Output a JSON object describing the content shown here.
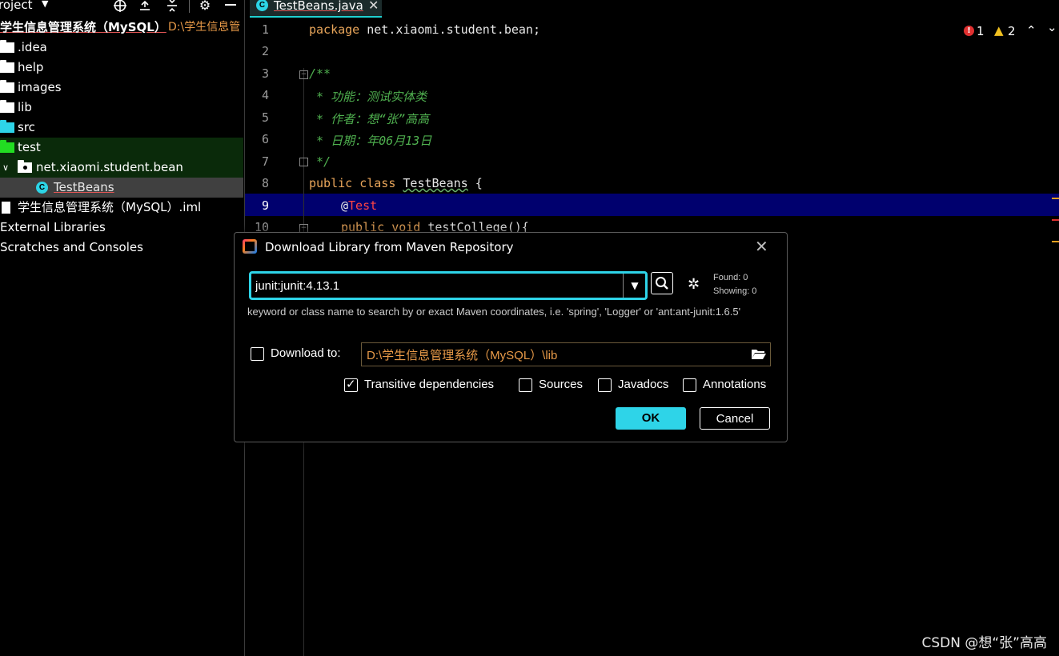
{
  "project_panel": {
    "title": "roject",
    "header_icons": [
      "crosshair-icon",
      "expand-all-icon",
      "collapse-all-icon",
      "gear-icon",
      "minimize-icon"
    ],
    "root": {
      "name": "学生信息管理系统（MySQL）",
      "path": "D:\\学生信息管"
    },
    "items": [
      {
        "label": ".idea",
        "type": "folder",
        "color": "#ffffff"
      },
      {
        "label": "help",
        "type": "folder",
        "color": "#ffffff"
      },
      {
        "label": "images",
        "type": "folder",
        "color": "#ffffff"
      },
      {
        "label": "lib",
        "type": "folder",
        "color": "#ffffff"
      },
      {
        "label": "src",
        "type": "folder",
        "color": "#2ed4e8"
      },
      {
        "label": "test",
        "type": "folder",
        "color": "#22dd22"
      },
      {
        "label": "net.xiaomi.student.bean",
        "type": "package",
        "color": "#ffffff"
      },
      {
        "label": "TestBeans",
        "type": "class",
        "color": "#2ed4e8"
      },
      {
        "label": "学生信息管理系统（MySQL）.iml",
        "type": "module-file",
        "color": "#ffffff"
      },
      {
        "label": "External Libraries",
        "type": "libraries",
        "color": "#ffffff"
      },
      {
        "label": "Scratches and Consoles",
        "type": "scratches",
        "color": "#ffffff"
      }
    ]
  },
  "editor": {
    "tab": {
      "label": "TestBeans.java",
      "badge": "C"
    },
    "inspection": {
      "errors": "1",
      "warnings": "2"
    },
    "line_numbers": [
      "1",
      "2",
      "3",
      "4",
      "5",
      "6",
      "7",
      "8",
      "9",
      "10"
    ],
    "code": {
      "l1_kw": "package",
      "l1_rest": " net.xiaomi.student.bean;",
      "l3": "/**",
      "l4": " * 功能：测试实体类",
      "l5": " * 作者：想“张”高高",
      "l6": " * 日期：年06月13日",
      "l7": " */",
      "l8_kw": "public class",
      "l8_name": "TestBeans",
      "l8_rest": " {",
      "l9_at": "@",
      "l9_name": "Test",
      "l10_kw": "public void",
      "l10_rest": " testCollege(){"
    }
  },
  "dialog": {
    "title": "Download Library from Maven Repository",
    "search_value": "junit:junit:4.13.1",
    "found": "Found: 0",
    "showing": "Showing: 0",
    "hint": "keyword or class name to search by or exact Maven coordinates, i.e. 'spring', 'Logger' or 'ant:ant-junit:1.6.5'",
    "download_to_label": "Download to:",
    "download_to_checked": false,
    "download_path": "D:\\学生信息管理系统（MySQL）\\lib",
    "options": [
      {
        "label": "Transitive dependencies",
        "checked": true
      },
      {
        "label": "Sources",
        "checked": false
      },
      {
        "label": "Javadocs",
        "checked": false
      },
      {
        "label": "Annotations",
        "checked": false
      }
    ],
    "ok_label": "OK",
    "cancel_label": "Cancel"
  },
  "watermark": "CSDN @想“张”高高",
  "colors": {
    "accent": "#2ed4e8",
    "keyword": "#e8a55a",
    "comment": "#4fb04f",
    "current_line": "#00006e",
    "path": "#e89a48"
  }
}
